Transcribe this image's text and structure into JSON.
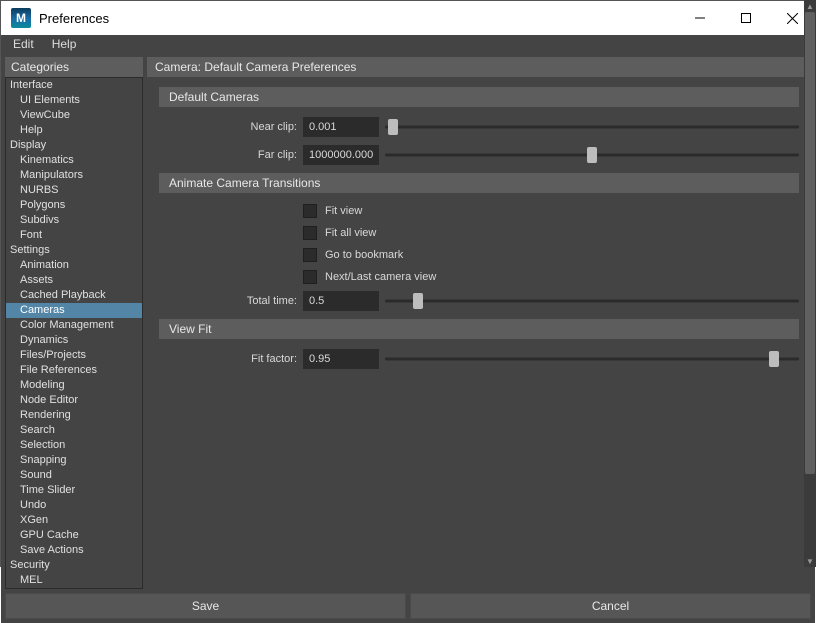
{
  "window": {
    "title": "Preferences"
  },
  "menu": {
    "edit": "Edit",
    "help": "Help"
  },
  "sidebar": {
    "header": "Categories",
    "groups": [
      {
        "label": "Interface",
        "items": [
          "UI Elements",
          "ViewCube",
          "Help"
        ]
      },
      {
        "label": "Display",
        "items": [
          "Kinematics",
          "Manipulators",
          "NURBS",
          "Polygons",
          "Subdivs",
          "Font"
        ]
      },
      {
        "label": "Settings",
        "items": [
          "Animation",
          "Assets",
          "Cached Playback",
          "Cameras",
          "Color Management",
          "Dynamics",
          "Files/Projects",
          "File References",
          "Modeling",
          "Node Editor",
          "Rendering",
          "Search",
          "Selection",
          "Snapping",
          "Sound",
          "Time Slider",
          "Undo",
          "XGen",
          "GPU Cache",
          "Save Actions"
        ]
      },
      {
        "label": "Security",
        "items": [
          "MEL"
        ]
      }
    ],
    "selected": "Cameras"
  },
  "content": {
    "header": "Camera: Default Camera Preferences",
    "default_cameras": {
      "title": "Default Cameras",
      "near_clip": {
        "label": "Near clip:",
        "value": "0.001",
        "slider_pos": 0.02
      },
      "far_clip": {
        "label": "Far clip:",
        "value": "1000000.000",
        "slider_pos": 0.5
      }
    },
    "animate_transitions": {
      "title": "Animate Camera Transitions",
      "options": [
        {
          "label": "Fit view"
        },
        {
          "label": "Fit all view"
        },
        {
          "label": "Go to bookmark"
        },
        {
          "label": "Next/Last camera view"
        }
      ],
      "total_time": {
        "label": "Total time:",
        "value": "0.5",
        "slider_pos": 0.08
      }
    },
    "view_fit": {
      "title": "View Fit",
      "fit_factor": {
        "label": "Fit factor:",
        "value": "0.95",
        "slider_pos": 0.94
      }
    }
  },
  "buttons": {
    "save": "Save",
    "cancel": "Cancel"
  }
}
